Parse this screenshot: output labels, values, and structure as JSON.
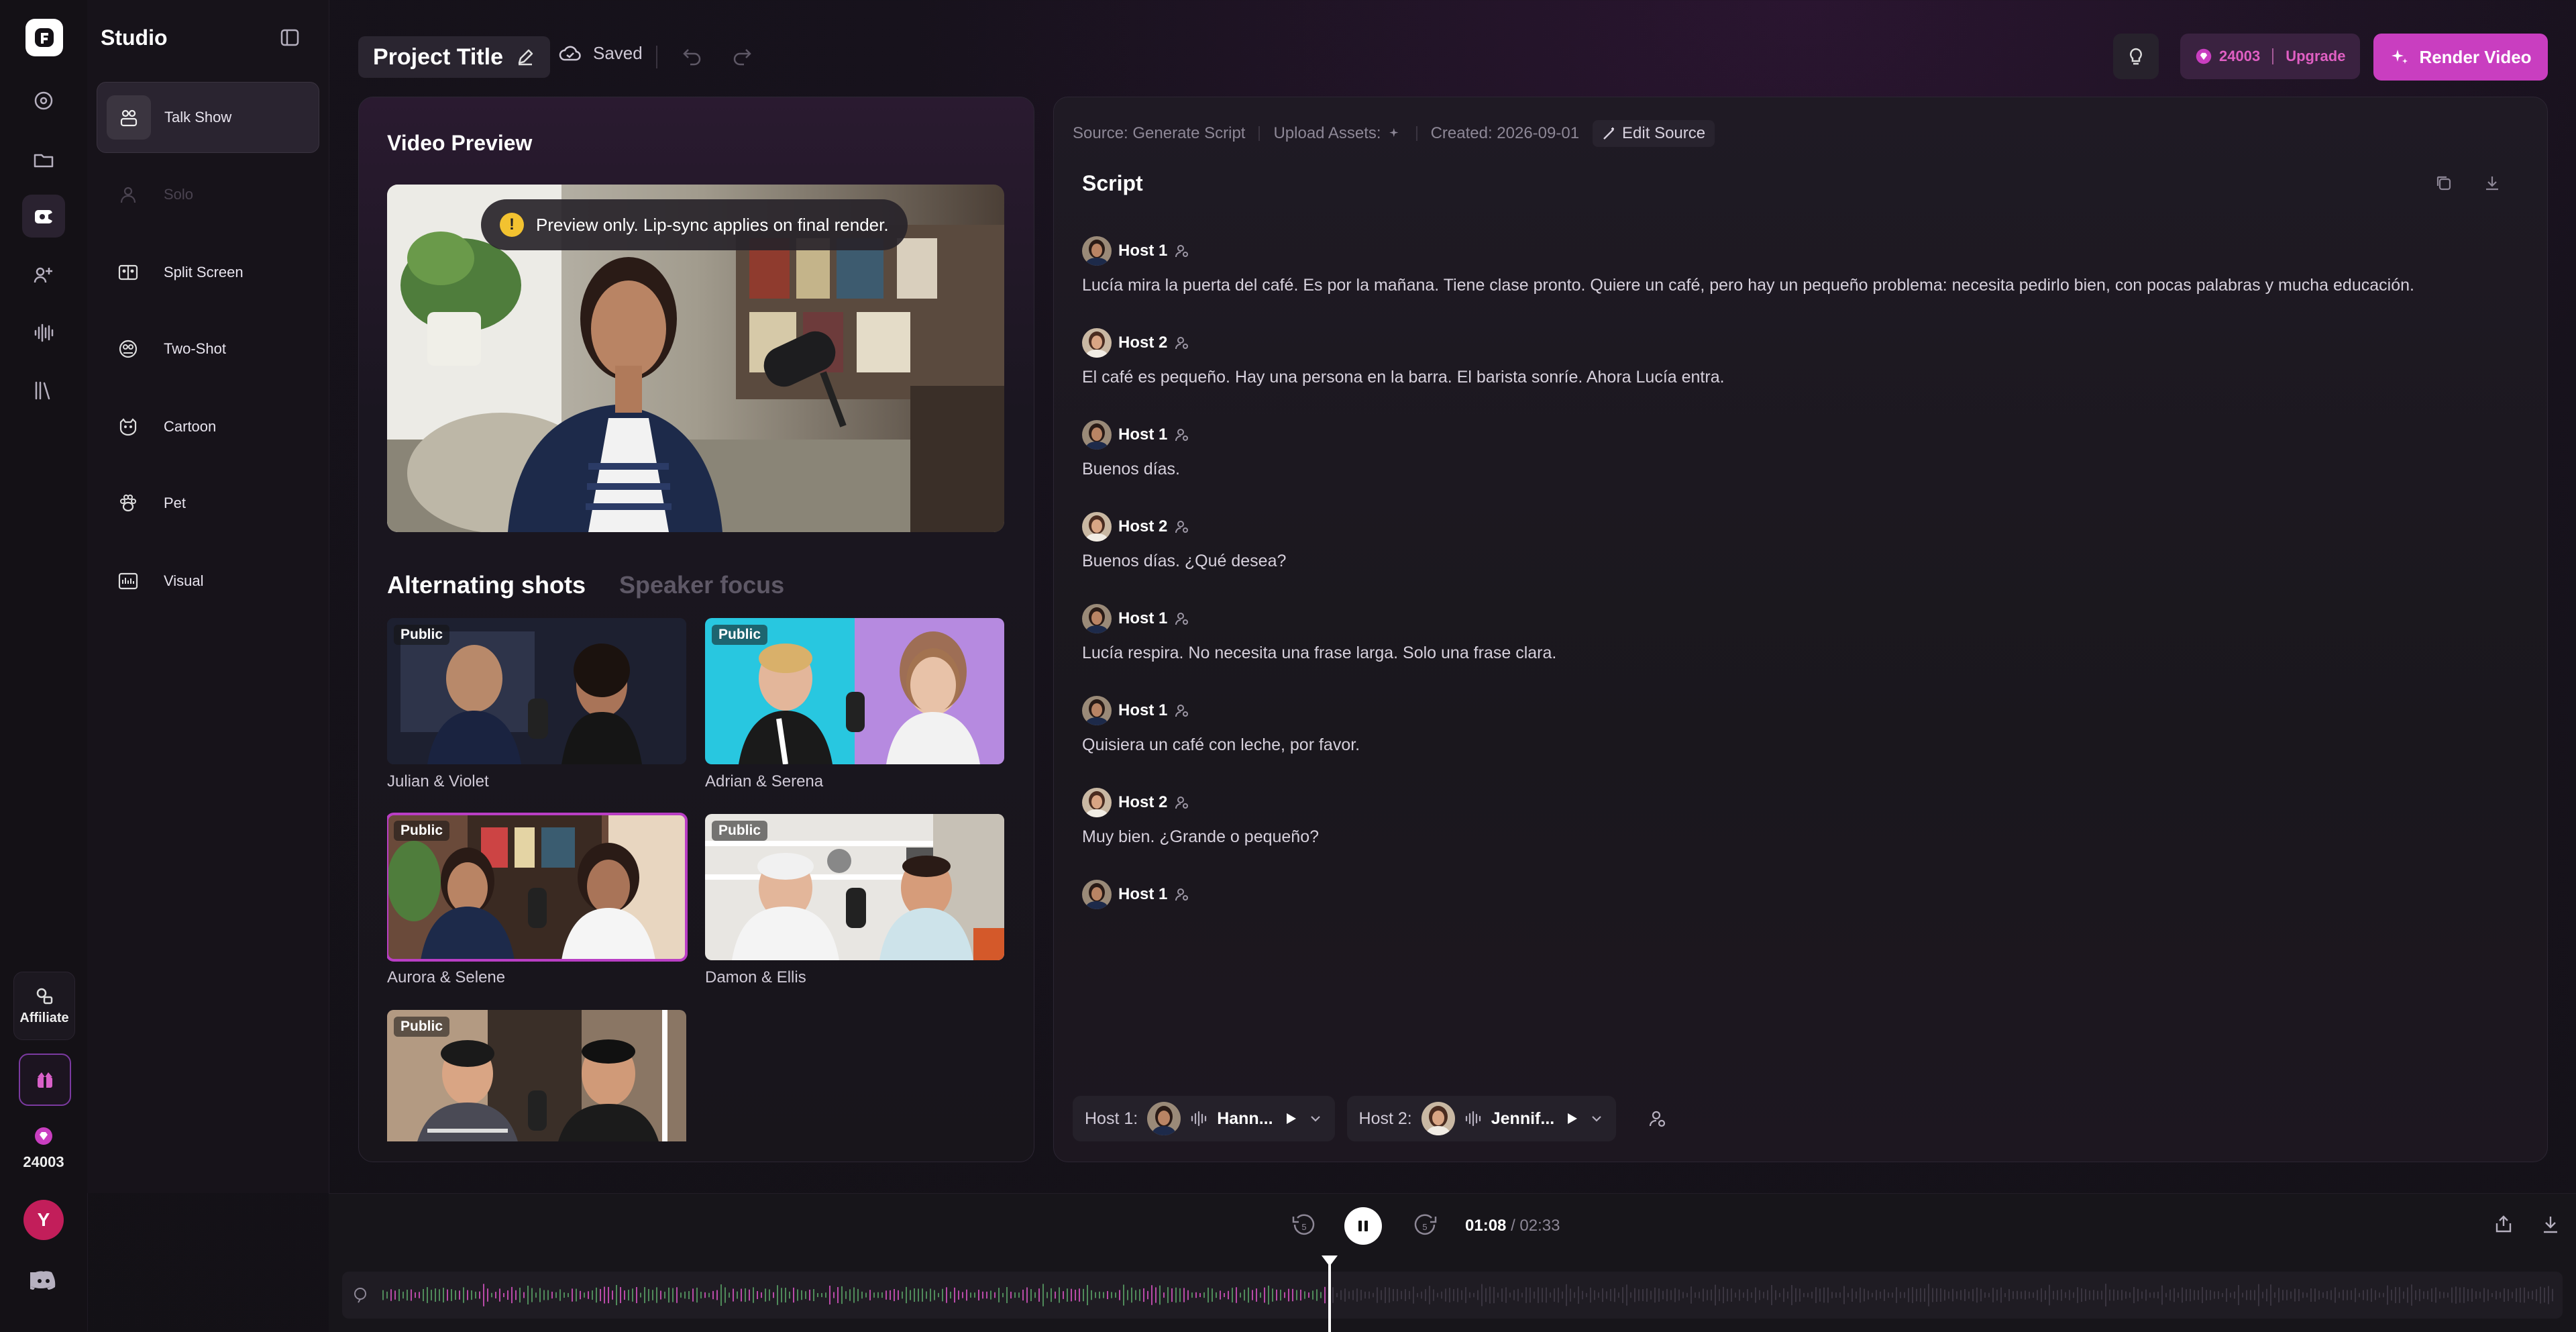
{
  "rail": {
    "affiliate_label": "Affiliate",
    "credits": "24003",
    "avatar_initial": "Y"
  },
  "studio": {
    "title": "Studio",
    "items": [
      {
        "label": "Talk Show",
        "active": true,
        "disabled": false,
        "icon": "talk-show-icon"
      },
      {
        "label": "Solo",
        "active": false,
        "disabled": true,
        "icon": "solo-icon"
      },
      {
        "label": "Split Screen",
        "active": false,
        "disabled": false,
        "icon": "split-screen-icon"
      },
      {
        "label": "Two-Shot",
        "active": false,
        "disabled": false,
        "icon": "two-shot-icon"
      },
      {
        "label": "Cartoon",
        "active": false,
        "disabled": false,
        "icon": "cartoon-icon"
      },
      {
        "label": "Pet",
        "active": false,
        "disabled": false,
        "icon": "paw-icon"
      },
      {
        "label": "Visual",
        "active": false,
        "disabled": false,
        "icon": "visual-icon"
      }
    ]
  },
  "topbar": {
    "project_title": "Project Title",
    "saved": "Saved",
    "credits": "24003",
    "upgrade": "Upgrade",
    "render": "Render Video"
  },
  "preview": {
    "title": "Video Preview",
    "toast": "Preview only. Lip-sync applies on final render.",
    "toast_icon": "!"
  },
  "shots": {
    "tabs": [
      "Alternating shots",
      "Speaker focus"
    ],
    "active_tab": 0,
    "cards": [
      {
        "name": "Julian & Violet",
        "badge": "Public",
        "selected": false
      },
      {
        "name": "Adrian & Serena",
        "badge": "Public",
        "selected": false
      },
      {
        "name": "Aurora & Selene",
        "badge": "Public",
        "selected": true
      },
      {
        "name": "Damon & Ellis",
        "badge": "Public",
        "selected": false
      },
      {
        "name": "",
        "badge": "Public",
        "selected": false
      }
    ]
  },
  "script": {
    "meta_source": "Source: Generate Script",
    "meta_upload": "Upload Assets:",
    "meta_created": "Created: 2026-09-01",
    "edit_source": "Edit Source",
    "title": "Script",
    "lines": [
      {
        "speaker": "Host 1",
        "text": "Lucía mira la puerta del café. Es por la mañana. Tiene clase pronto. Quiere un café, pero hay un pequeño problema: necesita pedirlo bien, con pocas palabras y mucha educación."
      },
      {
        "speaker": "Host 2",
        "text": "El café es pequeño. Hay una persona en la barra. El barista sonríe. Ahora Lucía entra."
      },
      {
        "speaker": "Host 1",
        "text": "Buenos días."
      },
      {
        "speaker": "Host 2",
        "text": "Buenos días. ¿Qué desea?"
      },
      {
        "speaker": "Host 1",
        "text": "Lucía respira. No necesita una frase larga. Solo una frase clara."
      },
      {
        "speaker": "Host 1",
        "text": "Quisiera un café con leche, por favor."
      },
      {
        "speaker": "Host 2",
        "text": "Muy bien. ¿Grande o pequeño?"
      },
      {
        "speaker": "Host 1",
        "text": ""
      }
    ],
    "host1_label": "Host 1:",
    "host1_voice": "Hann...",
    "host2_label": "Host 2:",
    "host2_voice": "Jennif..."
  },
  "player": {
    "current": "01:08",
    "separator": "/",
    "total": "02:33",
    "progress": 0.444
  },
  "colors": {
    "accent": "#c93ec0",
    "bg": "#131116",
    "panel": "#1a171d"
  }
}
